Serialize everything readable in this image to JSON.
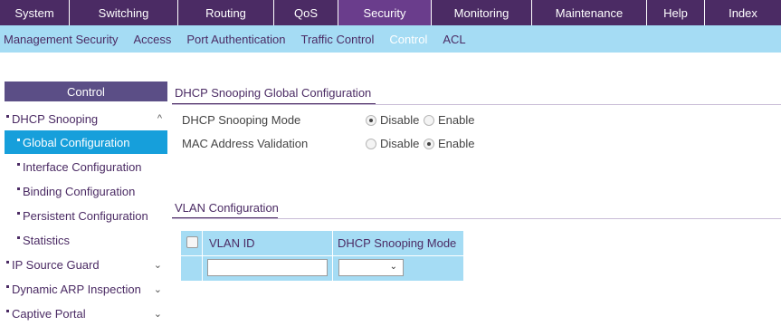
{
  "topnav": [
    {
      "label": "System",
      "w": 77
    },
    {
      "label": "Switching",
      "w": 120
    },
    {
      "label": "Routing",
      "w": 106
    },
    {
      "label": "QoS",
      "w": 71
    },
    {
      "label": "Security",
      "w": 103,
      "active": true
    },
    {
      "label": "Monitoring",
      "w": 111
    },
    {
      "label": "Maintenance",
      "w": 127
    },
    {
      "label": "Help",
      "w": 64
    },
    {
      "label": "Index",
      "w": 84
    }
  ],
  "subnav": [
    {
      "label": "Management Security"
    },
    {
      "label": "Access"
    },
    {
      "label": "Port Authentication"
    },
    {
      "label": "Traffic Control"
    },
    {
      "label": "Control",
      "active": true
    },
    {
      "label": "ACL"
    }
  ],
  "sidebar": {
    "header": "Control",
    "items": [
      {
        "label": "DHCP Snooping",
        "chevron": "^"
      },
      {
        "label": "Global Configuration",
        "selected": true
      },
      {
        "label": "Interface Configuration"
      },
      {
        "label": "Binding Configuration"
      },
      {
        "label": "Persistent Configuration"
      },
      {
        "label": "Statistics"
      },
      {
        "label": "IP Source Guard",
        "chevron": "⌄"
      },
      {
        "label": "Dynamic ARP Inspection",
        "chevron": "⌄"
      },
      {
        "label": "Captive Portal",
        "chevron": "⌄"
      }
    ]
  },
  "global": {
    "title": "DHCP Snooping Global Configuration",
    "mode_label": "DHCP Snooping Mode",
    "mode_value": "Disable",
    "mac_label": "MAC Address Validation",
    "mac_value": "Enable",
    "opt_disable": "Disable",
    "opt_enable": "Enable"
  },
  "vlan": {
    "title": "VLAN Configuration",
    "col_id": "VLAN ID",
    "col_mode": "DHCP Snooping Mode",
    "input_value": "",
    "select_value": ""
  },
  "colors": {
    "nav_bg": "#4b2b64",
    "nav_active": "#6a3d8c",
    "subnav_bg": "#a5dcf4",
    "side_sel": "#169fdb",
    "side_head": "#5b4e86"
  }
}
